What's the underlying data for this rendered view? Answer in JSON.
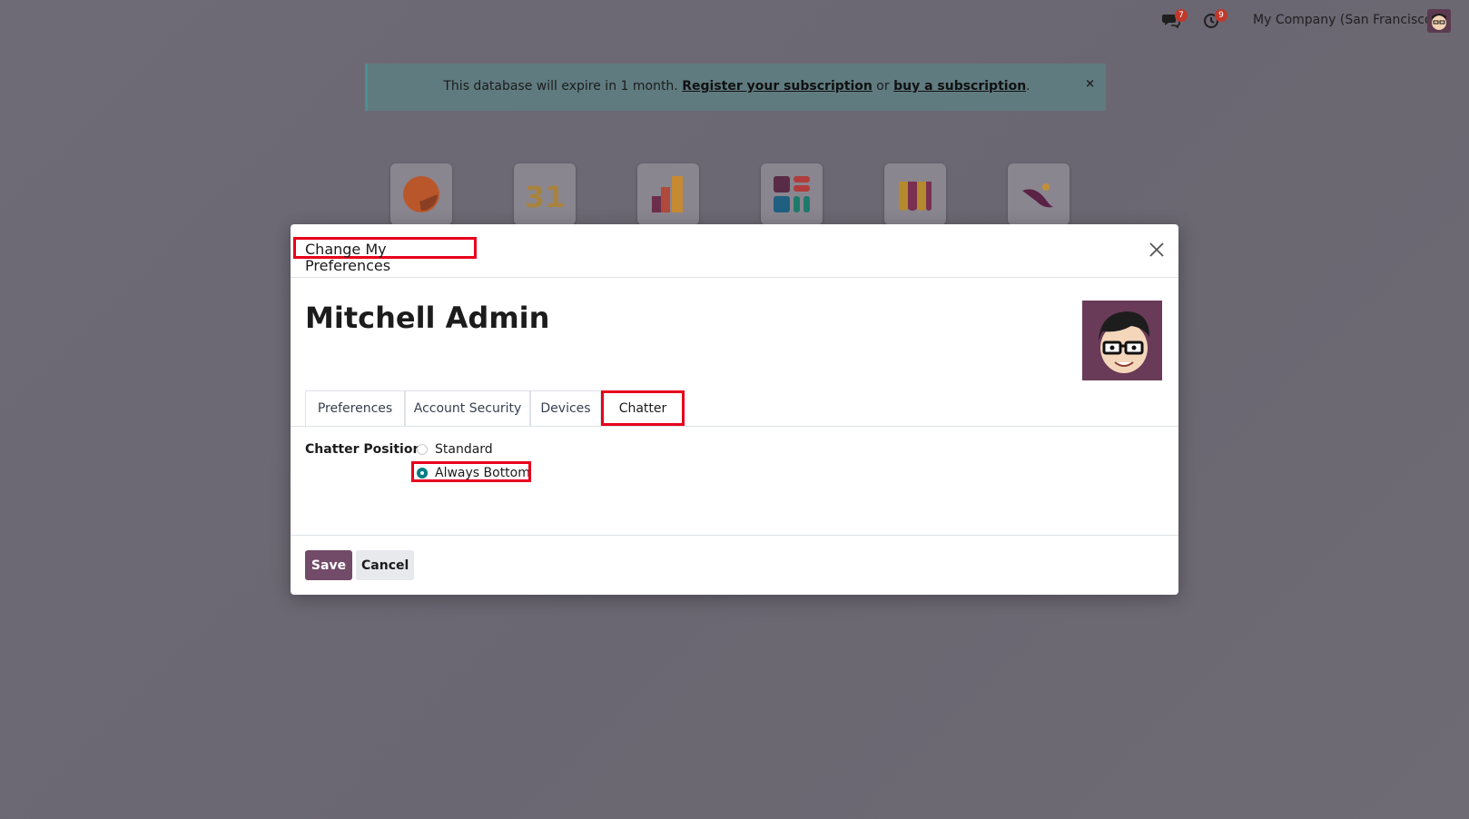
{
  "topbar": {
    "messages_badge": "7",
    "activities_badge": "9",
    "company": "My Company (San Francisco)"
  },
  "banner": {
    "text_before": "This database will expire in 1 month. ",
    "register_link": "Register your subscription",
    "text_middle": " or ",
    "buy_link": "buy a subscription",
    "text_after": ".",
    "close": "×"
  },
  "apps": [
    {
      "icon": "discuss-icon"
    },
    {
      "icon": "calendar-icon",
      "label": "31"
    },
    {
      "icon": "dashboards-icon"
    },
    {
      "icon": "apps-grid-icon"
    },
    {
      "icon": "shop-icon"
    },
    {
      "icon": "quill-icon"
    }
  ],
  "dialog": {
    "title": "Change My Preferences",
    "user_name": "Mitchell Admin",
    "tabs": [
      {
        "label": "Preferences"
      },
      {
        "label": "Account Security"
      },
      {
        "label": "Devices"
      },
      {
        "label": "Chatter",
        "active": true
      }
    ],
    "chatter_position": {
      "label": "Chatter Position",
      "options": [
        {
          "label": "Standard",
          "checked": false
        },
        {
          "label": "Always Bottom",
          "checked": true
        }
      ]
    },
    "save_label": "Save",
    "cancel_label": "Cancel"
  },
  "colors": {
    "primary": "#714b67",
    "radio_checked": "#017e84",
    "highlight": "#e8001c"
  }
}
